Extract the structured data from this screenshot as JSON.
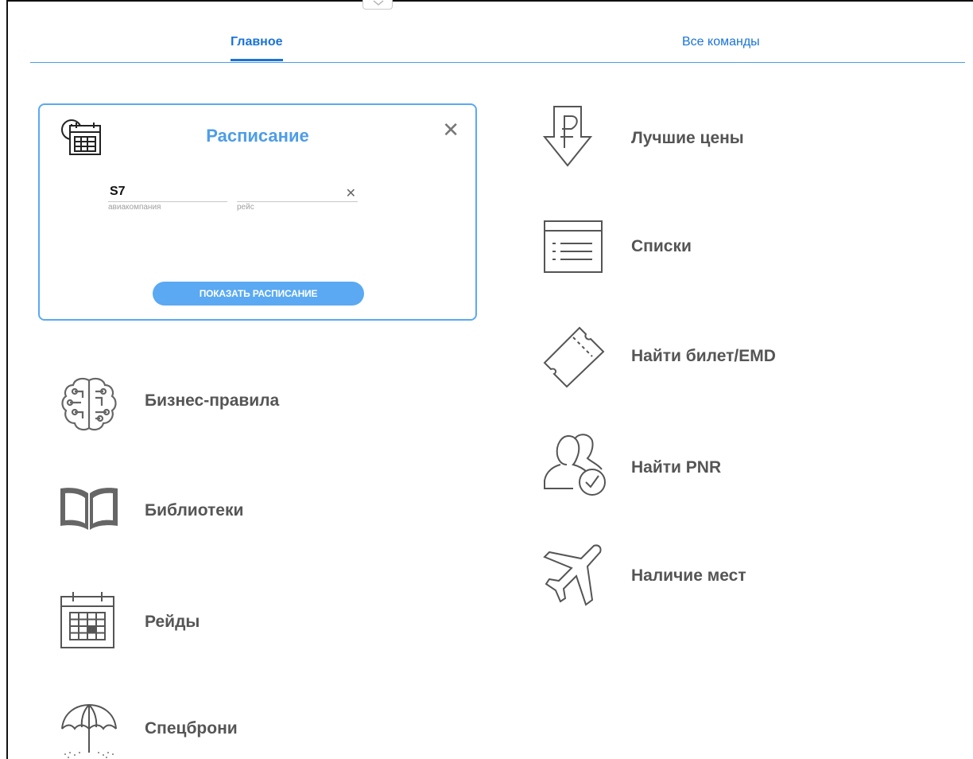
{
  "tabs": {
    "main": "Главное",
    "all": "Все команды"
  },
  "schedule": {
    "title": "Расписание",
    "airline_value": "S7",
    "airline_label": "авиакомпания",
    "flight_value": "",
    "flight_label": "рейс",
    "show_button": "ПОКАЗАТЬ РАСПИСАНИЕ"
  },
  "left_commands": [
    {
      "label": "Бизнес-правила",
      "icon": "brain-icon"
    },
    {
      "label": "Библиотеки",
      "icon": "book-icon"
    },
    {
      "label": "Рейды",
      "icon": "calendar-icon"
    },
    {
      "label": "Спецброни",
      "icon": "beach-umbrella-icon"
    }
  ],
  "right_commands": [
    {
      "label": "Лучшие цены",
      "icon": "ruble-arrow-icon"
    },
    {
      "label": "Списки",
      "icon": "list-document-icon"
    },
    {
      "label": "Найти билет/EMD",
      "icon": "ticket-icon"
    },
    {
      "label": "Найти PNR",
      "icon": "passengers-check-icon"
    },
    {
      "label": "Наличие мест",
      "icon": "airplane-icon"
    }
  ],
  "colors": {
    "accent": "#1a73d9",
    "card_border": "#5aa9f2",
    "text": "#555555"
  }
}
